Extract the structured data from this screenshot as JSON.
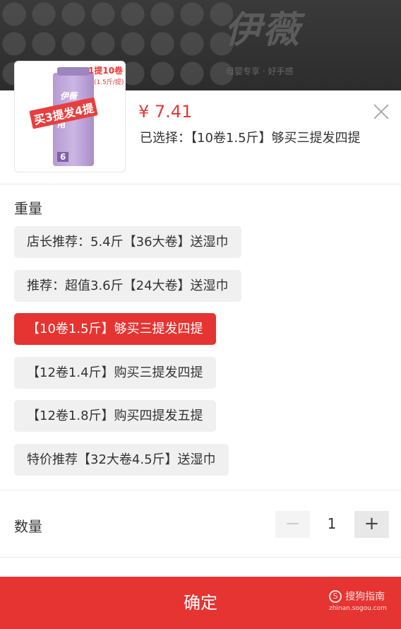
{
  "background": {
    "brand": "伊薇",
    "tagline": "母婴专享 · 好手感"
  },
  "thumbnail": {
    "badge_main": "1提10卷",
    "badge_sub": "(1.5斤/提)",
    "promo": "买3提发4提",
    "pack_brand": "伊薇",
    "pack_label": "母婴适用",
    "pack_count": "6"
  },
  "header": {
    "price": "¥ 7.41",
    "selected": "已选择：【10卷1.5斤】够买三提发四提"
  },
  "weight": {
    "title": "重量",
    "options": [
      "店长推荐：5.4斤【36大卷】送湿巾",
      "推荐：超值3.6斤【24大卷】送湿巾",
      "【10卷1.5斤】够买三提发四提",
      "【12卷1.4斤】购买三提发四提",
      "【12卷1.8斤】购买四提发五提",
      "特价推荐【32大卷4.5斤】送湿巾"
    ],
    "selected_index": 2
  },
  "quantity": {
    "title": "数量",
    "minus": "−",
    "value": "1",
    "plus": "+"
  },
  "confirm": {
    "label": "确定"
  },
  "watermark": {
    "logo": "S",
    "name": "搜狗指南",
    "url": "zhinan.sogou.com"
  },
  "colors": {
    "accent": "#e53431",
    "price": "#e23b3b"
  }
}
